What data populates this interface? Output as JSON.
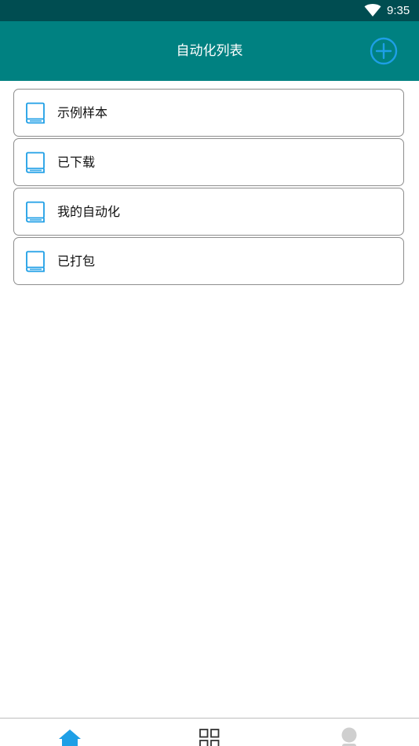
{
  "status_bar": {
    "time": "9:35",
    "wifi_icon": "wifi-icon"
  },
  "app_bar": {
    "title": "自动化列表",
    "add_icon": "add-circle-icon",
    "color": "#008181",
    "accent": "#1e9fe6"
  },
  "list": {
    "items": [
      {
        "label": "示例样本",
        "icon": "book-icon"
      },
      {
        "label": "已下载",
        "icon": "book-icon"
      },
      {
        "label": "我的自动化",
        "icon": "book-icon"
      },
      {
        "label": "已打包",
        "icon": "book-icon"
      }
    ]
  },
  "bottom_nav": {
    "items": [
      {
        "icon": "home-icon",
        "active": true
      },
      {
        "icon": "grid-icon",
        "active": false
      },
      {
        "icon": "profile-icon",
        "active": false
      }
    ],
    "active_color": "#1e9fe6"
  }
}
